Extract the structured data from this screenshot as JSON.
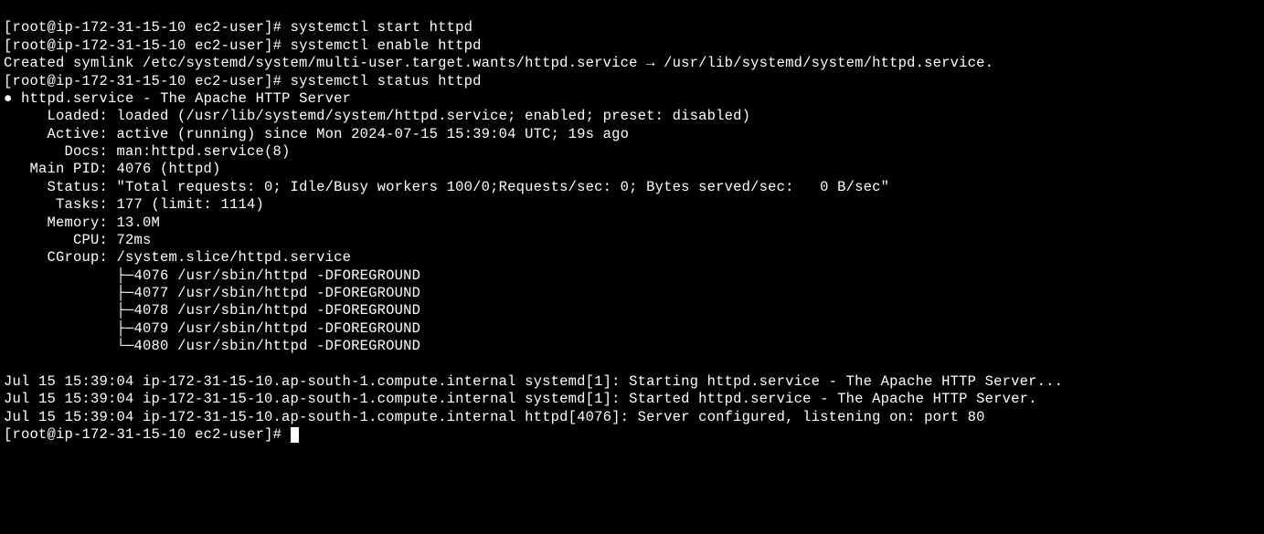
{
  "prompts": [
    {
      "userhost": "root@ip-172-31-15-10",
      "dir": "ec2-user"
    },
    {
      "userhost": "root@ip-172-31-15-10",
      "dir": "ec2-user"
    },
    {
      "userhost": "root@ip-172-31-15-10",
      "dir": "ec2-user"
    },
    {
      "userhost": "root@ip-172-31-15-10",
      "dir": "ec2-user"
    }
  ],
  "commands": [
    "systemctl start httpd",
    "systemctl enable httpd",
    "systemctl status httpd"
  ],
  "enable_output": "Created symlink /etc/systemd/system/multi-user.target.wants/httpd.service → /usr/lib/systemd/system/httpd.service.",
  "status": {
    "unit": "httpd.service",
    "desc": "The Apache HTTP Server",
    "loaded": "loaded (/usr/lib/systemd/system/httpd.service; enabled; preset: disabled)",
    "active": "active (running) since Mon 2024-07-15 15:39:04 UTC; 19s ago",
    "docs": "man:httpd.service(8)",
    "mainpid": "4076 (httpd)",
    "status_line": "\"Total requests: 0; Idle/Busy workers 100/0;Requests/sec: 0; Bytes served/sec:   0 B/sec\"",
    "tasks": "177 (limit: 1114)",
    "memory": "13.0M",
    "cpu": "72ms",
    "cgroup": "/system.slice/httpd.service",
    "procs": [
      {
        "pid": "4076",
        "cmd": "/usr/sbin/httpd -DFOREGROUND"
      },
      {
        "pid": "4077",
        "cmd": "/usr/sbin/httpd -DFOREGROUND"
      },
      {
        "pid": "4078",
        "cmd": "/usr/sbin/httpd -DFOREGROUND"
      },
      {
        "pid": "4079",
        "cmd": "/usr/sbin/httpd -DFOREGROUND"
      },
      {
        "pid": "4080",
        "cmd": "/usr/sbin/httpd -DFOREGROUND"
      }
    ]
  },
  "journal": [
    "Jul 15 15:39:04 ip-172-31-15-10.ap-south-1.compute.internal systemd[1]: Starting httpd.service - The Apache HTTP Server...",
    "Jul 15 15:39:04 ip-172-31-15-10.ap-south-1.compute.internal systemd[1]: Started httpd.service - The Apache HTTP Server.",
    "Jul 15 15:39:04 ip-172-31-15-10.ap-south-1.compute.internal httpd[4076]: Server configured, listening on: port 80"
  ]
}
